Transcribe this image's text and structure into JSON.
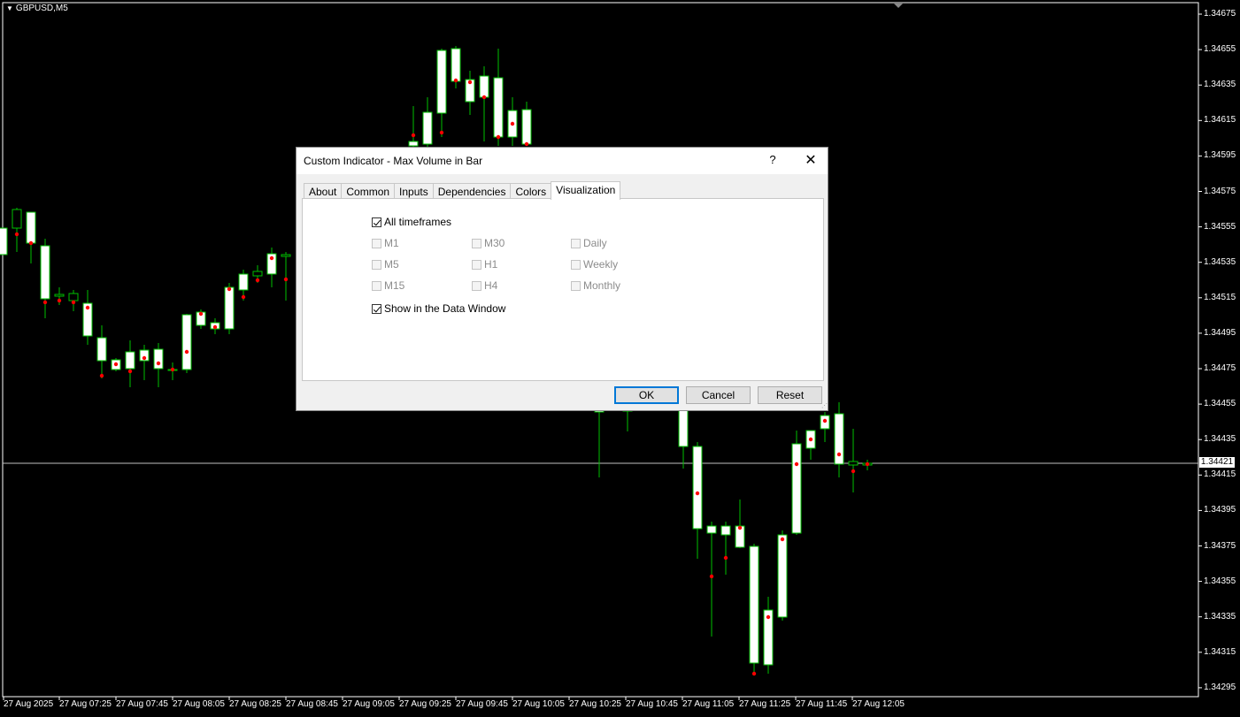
{
  "chart": {
    "symbol": "GBPUSD,M5",
    "current_price": "1.34421",
    "colors": {
      "background": "#000000",
      "bull": "#ffffff",
      "outline": "#00c000",
      "marker": "#ff0000",
      "axis": "#ffffff"
    },
    "price_axis": [
      "1.34675",
      "1.34655",
      "1.34635",
      "1.34615",
      "1.34595",
      "1.34575",
      "1.34555",
      "1.34535",
      "1.34515",
      "1.34495",
      "1.34475",
      "1.34455",
      "1.34435",
      "1.34415",
      "1.34395",
      "1.34375",
      "1.34355",
      "1.34335",
      "1.34315",
      "1.34295"
    ],
    "time_axis": [
      "27 Aug 2025",
      "27 Aug 07:25",
      "27 Aug 07:45",
      "27 Aug 08:05",
      "27 Aug 08:25",
      "27 Aug 08:45",
      "27 Aug 09:05",
      "27 Aug 09:25",
      "27 Aug 09:45",
      "27 Aug 10:05",
      "27 Aug 10:25",
      "27 Aug 10:45",
      "27 Aug 11:05",
      "27 Aug 11:25",
      "27 Aug 11:45",
      "27 Aug 12:05"
    ]
  },
  "dialog": {
    "title": "Custom Indicator - Max Volume in Bar",
    "help": "?",
    "close": "✕",
    "tabs": [
      "About",
      "Common",
      "Inputs",
      "Dependencies",
      "Colors",
      "Visualization"
    ],
    "active_tab": "Visualization",
    "all_timeframes": {
      "label": "All timeframes",
      "checked": true
    },
    "timeframes": [
      {
        "label": "M1",
        "checked": false
      },
      {
        "label": "M5",
        "checked": false
      },
      {
        "label": "M15",
        "checked": false
      },
      {
        "label": "M30",
        "checked": false
      },
      {
        "label": "H1",
        "checked": false
      },
      {
        "label": "H4",
        "checked": false
      },
      {
        "label": "Daily",
        "checked": false
      },
      {
        "label": "Weekly",
        "checked": false
      },
      {
        "label": "Monthly",
        "checked": false
      }
    ],
    "data_window": {
      "label": "Show in the Data Window",
      "checked": true
    },
    "buttons": {
      "ok": "OK",
      "cancel": "Cancel",
      "reset": "Reset"
    }
  }
}
